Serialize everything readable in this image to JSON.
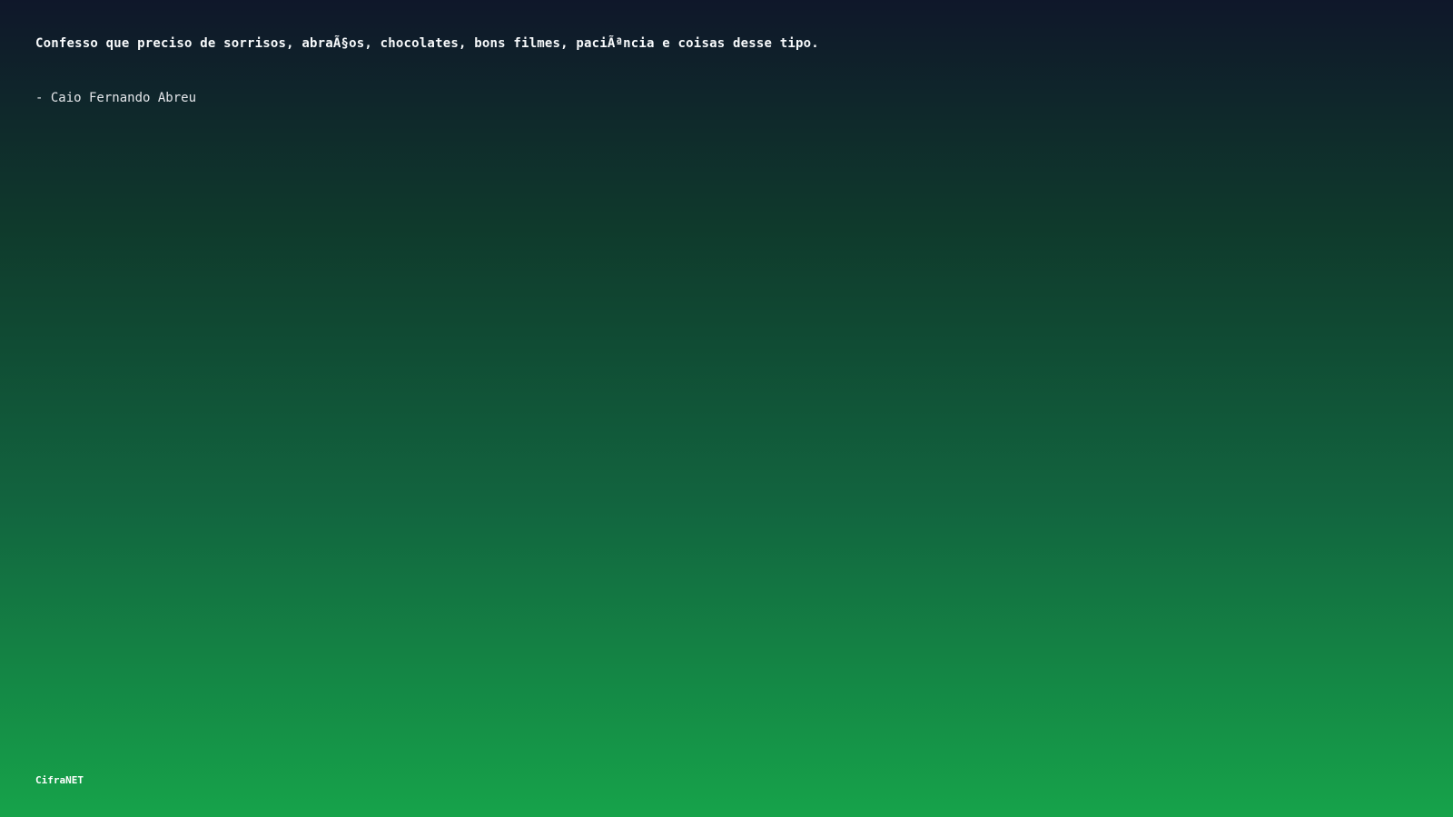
{
  "quote": {
    "text": "Confesso que preciso de sorrisos, abraÃ§os, chocolates, bons filmes, paciÃªncia e coisas desse tipo.",
    "author": "- Caio Fernando Abreu"
  },
  "footer": {
    "brand": "CifraNET"
  },
  "colors": {
    "gradient_top": "#0f172a",
    "gradient_bottom": "#16a34a",
    "text": "#f8fafc"
  }
}
